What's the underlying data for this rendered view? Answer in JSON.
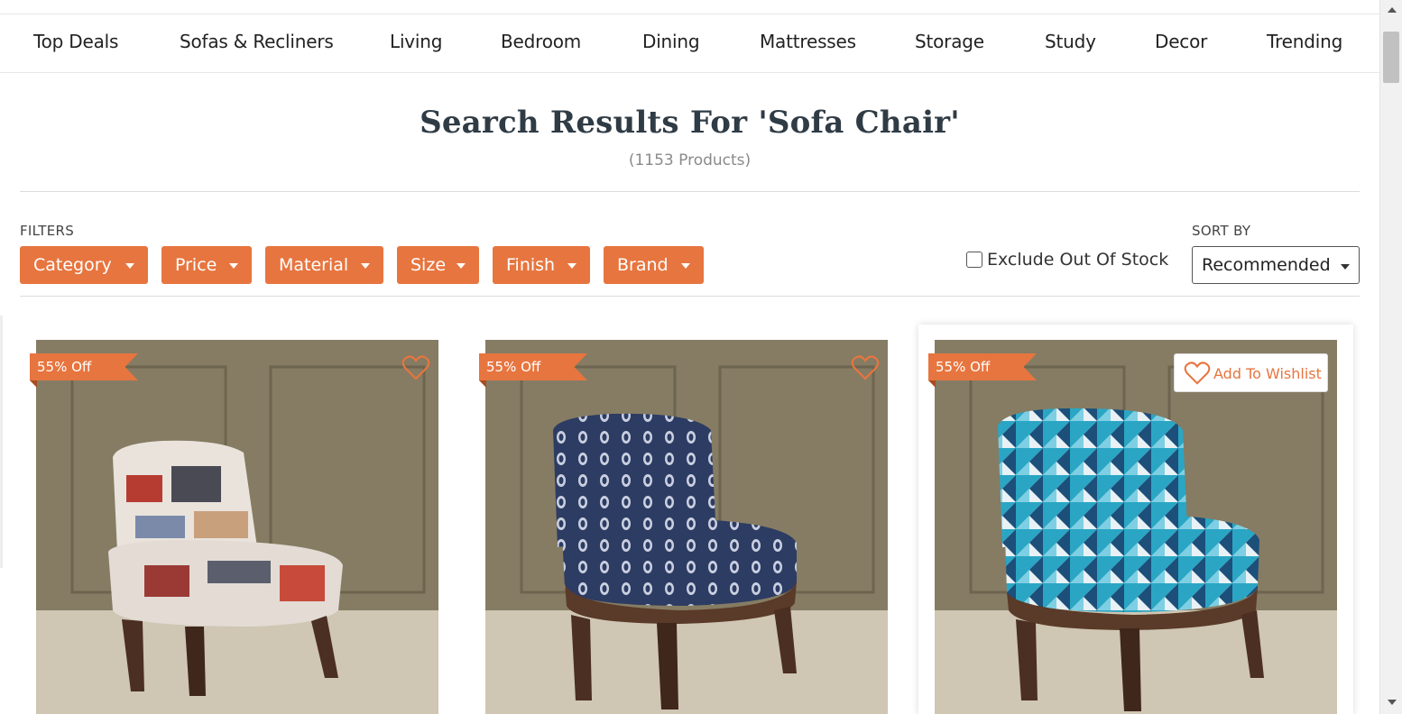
{
  "nav": {
    "items": [
      {
        "label": "Top Deals"
      },
      {
        "label": "Sofas & Recliners"
      },
      {
        "label": "Living"
      },
      {
        "label": "Bedroom"
      },
      {
        "label": "Dining"
      },
      {
        "label": "Mattresses"
      },
      {
        "label": "Storage"
      },
      {
        "label": "Study"
      },
      {
        "label": "Decor"
      },
      {
        "label": "Trending"
      }
    ]
  },
  "search": {
    "title": "Search Results For 'Sofa Chair'",
    "count": "(1153 Products)"
  },
  "filters": {
    "label": "FILTERS",
    "buttons": [
      {
        "label": "Category"
      },
      {
        "label": "Price"
      },
      {
        "label": "Material"
      },
      {
        "label": "Size"
      },
      {
        "label": "Finish"
      },
      {
        "label": "Brand"
      }
    ],
    "exclude_out_of_stock": {
      "label": "Exclude Out Of Stock",
      "checked": false
    }
  },
  "sort": {
    "label": "SORT BY",
    "selected": "Recommended"
  },
  "products": [
    {
      "discount": "55% Off",
      "pattern": "newspaper print",
      "wishlisted": false
    },
    {
      "discount": "55% Off",
      "pattern": "navy paisley print",
      "wishlisted": false
    },
    {
      "discount": "55% Off",
      "pattern": "blue geometric print",
      "wishlisted": false,
      "wishlist_label": "Add To Wishlist"
    }
  ],
  "colors": {
    "accent": "#e7753f",
    "title": "#2f3b45",
    "muted": "#8a8a8a"
  }
}
